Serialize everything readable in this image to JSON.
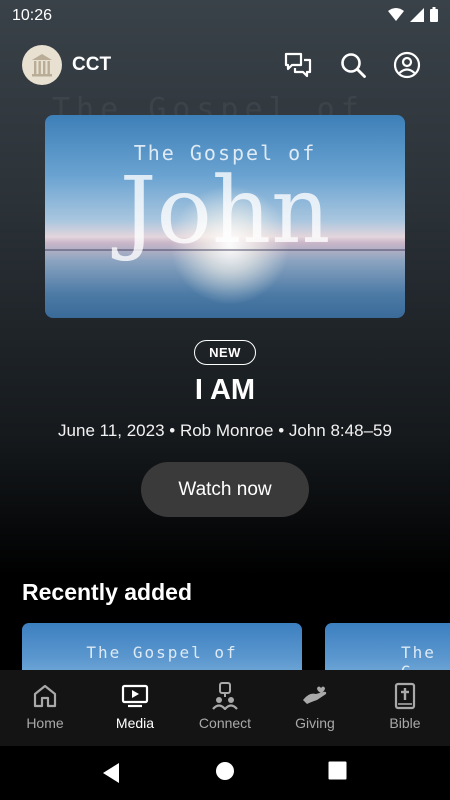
{
  "status_bar": {
    "time": "10:26"
  },
  "header": {
    "app_name": "CCT"
  },
  "hero": {
    "art_gospel": "The Gospel of",
    "art_john": "John",
    "badge": "NEW",
    "title": "I AM",
    "meta": "June 11, 2023 • Rob Monroe • John 8:48–59",
    "watch_label": "Watch now"
  },
  "recent": {
    "title": "Recently added",
    "items": [
      {
        "art_text": "The Gospel of"
      },
      {
        "art_text": "The G"
      }
    ]
  },
  "bottom_nav": {
    "items": [
      {
        "label": "Home",
        "icon": "home-icon",
        "active": false
      },
      {
        "label": "Media",
        "icon": "tv-icon",
        "active": true
      },
      {
        "label": "Connect",
        "icon": "people-icon",
        "active": false
      },
      {
        "label": "Giving",
        "icon": "hand-heart-icon",
        "active": false
      },
      {
        "label": "Bible",
        "icon": "bible-icon",
        "active": false
      }
    ]
  },
  "colors": {
    "background_top": "#3a4249",
    "nav_background": "#141414",
    "watch_button": "#3a3a3a",
    "inactive_label": "#a9a9a9"
  }
}
